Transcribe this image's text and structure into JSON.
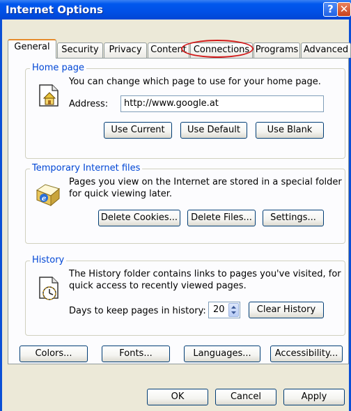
{
  "window": {
    "title": "Internet Options",
    "help_glyph": "?",
    "close_glyph": "✕"
  },
  "tabs": [
    {
      "label": "General",
      "active": true
    },
    {
      "label": "Security"
    },
    {
      "label": "Privacy"
    },
    {
      "label": "Content"
    },
    {
      "label": "Connections",
      "highlighted": true
    },
    {
      "label": "Programs"
    },
    {
      "label": "Advanced"
    }
  ],
  "home_page": {
    "legend": "Home page",
    "description": "You can change which page to use for your home page.",
    "address_label": "Address:",
    "address_value": "http://www.google.at",
    "use_current": "Use Current",
    "use_default": "Use Default",
    "use_blank": "Use Blank",
    "icon": "home-page-icon"
  },
  "temp_files": {
    "legend": "Temporary Internet files",
    "description_line1": "Pages you view on the Internet are stored in a special folder",
    "description_line2": "for quick viewing later.",
    "delete_cookies": "Delete Cookies...",
    "delete_files": "Delete Files...",
    "settings": "Settings...",
    "icon": "ie-folder-icon"
  },
  "history": {
    "legend": "History",
    "description_line1": "The History folder contains links to pages you've visited, for",
    "description_line2": "quick access to recently viewed pages.",
    "days_label": "Days to keep pages in history:",
    "days_value": "20",
    "clear_history": "Clear History",
    "icon": "history-clock-icon"
  },
  "bottom_buttons": {
    "colors": "Colors...",
    "fonts": "Fonts...",
    "languages": "Languages...",
    "accessibility": "Accessibility..."
  },
  "dialog_buttons": {
    "ok": "OK",
    "cancel": "Cancel",
    "apply": "Apply"
  },
  "colors": {
    "title_bar": "#0058ee",
    "highlight_ring": "#d21a1a",
    "group_label": "#0046d5",
    "active_tab_accent": "#e68b2c"
  }
}
